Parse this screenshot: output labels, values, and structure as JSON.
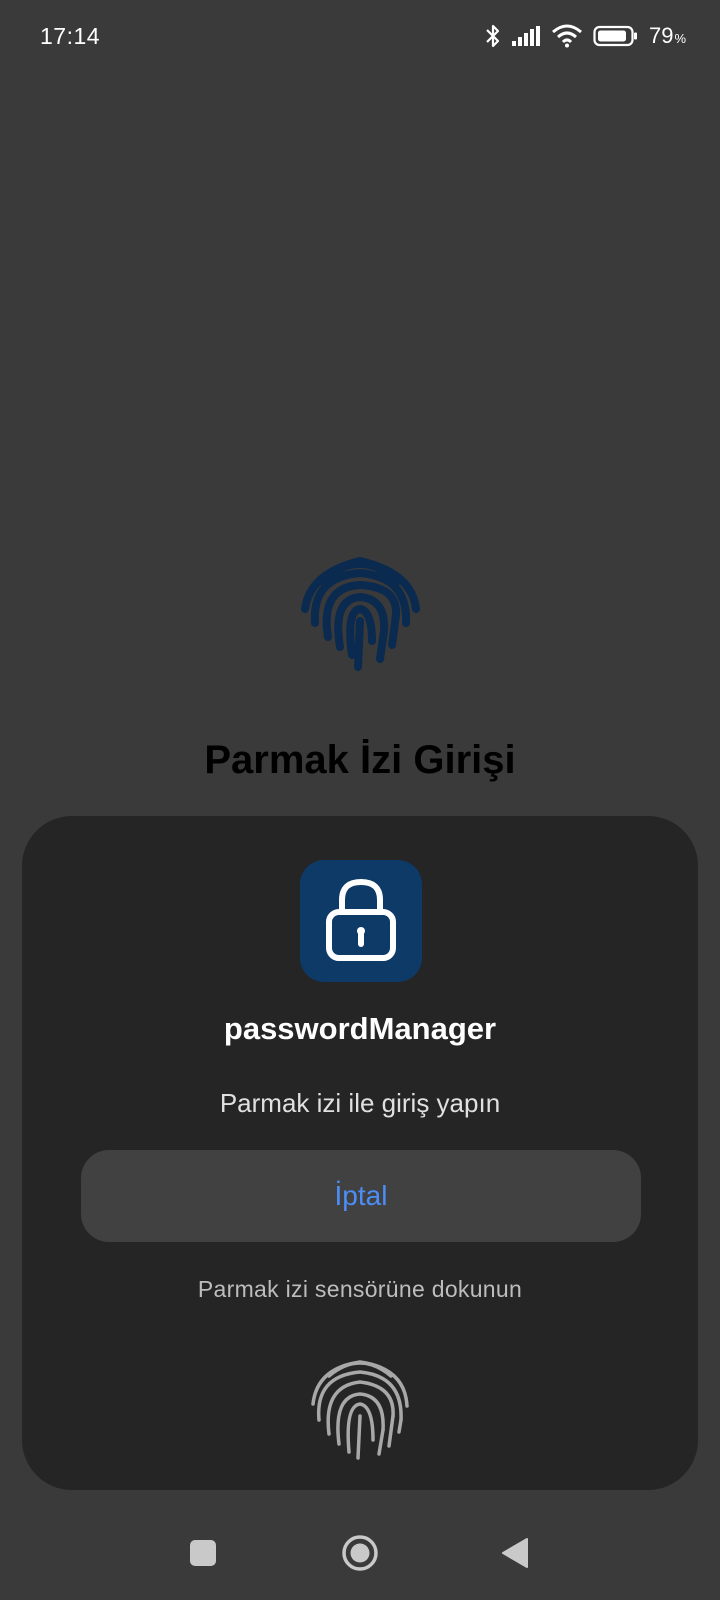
{
  "status_bar": {
    "time": "17:14",
    "battery_percent": "79",
    "battery_unit": "%",
    "icons": [
      "bluetooth-icon",
      "signal-icon",
      "wifi-icon",
      "battery-icon"
    ]
  },
  "background": {
    "title": "Parmak İzi Girişi",
    "icon": "fingerprint-icon",
    "icon_color": "#0b2a4f"
  },
  "dialog": {
    "app_icon": "lock-icon",
    "app_icon_bg": "#0d3a66",
    "app_name": "passwordManager",
    "prompt": "Parmak izi ile giriş yapın",
    "cancel_label": "İptal",
    "cancel_color": "#4c8ef7",
    "hint": "Parmak izi sensörüne dokunun",
    "sensor_icon": "fingerprint-icon"
  },
  "nav_bar": {
    "buttons": [
      "recents-icon",
      "home-icon",
      "back-icon"
    ]
  }
}
